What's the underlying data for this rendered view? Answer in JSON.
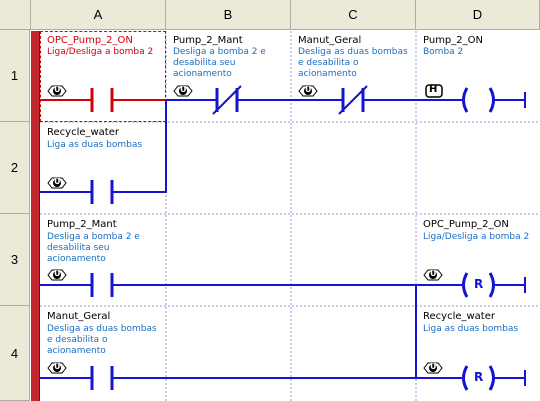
{
  "columns": [
    "A",
    "B",
    "C",
    "D"
  ],
  "rows": [
    "1",
    "2",
    "3",
    "4"
  ],
  "cells": {
    "r1a": {
      "tag": "OPC_Pump_2_ON",
      "desc": [
        "Liga/Desliga a bomba 2"
      ]
    },
    "r1b": {
      "tag": "Pump_2_Mant",
      "desc": [
        "Desliga a bomba 2 e",
        "desabilita seu",
        "acionamento"
      ]
    },
    "r1c": {
      "tag": "Manut_Geral",
      "desc": [
        "Desliga as duas bombas",
        "e desabilita o",
        "acionamento"
      ]
    },
    "r1d": {
      "tag": "Pump_2_ON",
      "desc": [
        "Bomba 2"
      ]
    },
    "r2a": {
      "tag": "Recycle_water",
      "desc": [
        "Liga as duas bombas"
      ]
    },
    "r3a": {
      "tag": "Pump_2_Mant",
      "desc": [
        "Desliga a bomba 2 e",
        "desabilita seu",
        "acionamento"
      ]
    },
    "r3d": {
      "tag": "OPC_Pump_2_ON",
      "desc": [
        "Liga/Desliga a bomba 2"
      ]
    },
    "r4a": {
      "tag": "Manut_Geral",
      "desc": [
        "Desliga as duas bombas",
        "e desabilita o",
        "acionamento"
      ]
    },
    "r4d": {
      "tag": "Recycle_water",
      "desc": [
        "Liga as duas bombas"
      ]
    }
  },
  "coil_letters": {
    "reset": "R",
    "hold": "H"
  },
  "icons": {
    "visibility_badge": "U"
  },
  "colors": {
    "wire": "#1414d2",
    "selected": "#d2000c",
    "rail": "#c1272d",
    "desc": "#1a6fc2"
  }
}
